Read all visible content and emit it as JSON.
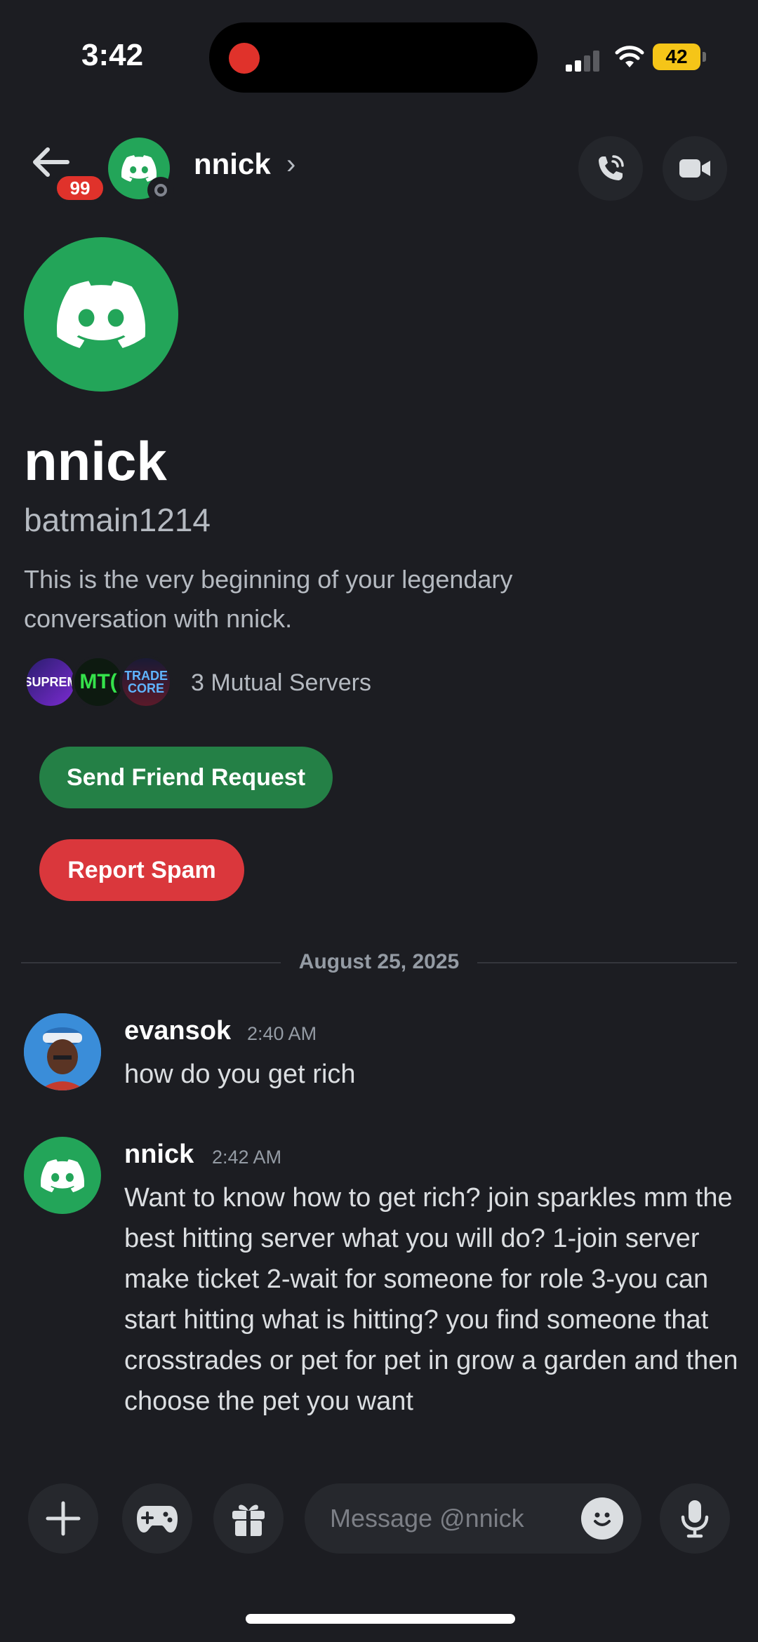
{
  "status_bar": {
    "time": "3:42",
    "battery": "42"
  },
  "header": {
    "badge_count": "99",
    "title": "nnick",
    "chevron": "›"
  },
  "profile": {
    "name": "nnick",
    "username": "batmain1214",
    "intro": "This is the very beginning of your legendary conversation with nnick.",
    "mutual_servers": "3 Mutual Servers",
    "server_icons": [
      {
        "label": "SUPREM"
      },
      {
        "label": "MT("
      },
      {
        "label": "TRADE CORE"
      }
    ],
    "send_friend_request": "Send Friend Request",
    "report_spam": "Report Spam"
  },
  "divider": {
    "date": "August 25, 2025"
  },
  "messages": [
    {
      "author": "evansok",
      "time": "2:40 AM",
      "text": "how do you get rich"
    },
    {
      "author": "nnick",
      "time": "2:42 AM",
      "text": "Want to know how to get rich? join sparkles mm the best hitting server what you will do? 1-join server make ticket 2-wait for someone for role 3-you can start hitting what is hitting? you find someone that crosstrades or pet for pet in grow a garden and then choose the pet you want"
    }
  ],
  "composer": {
    "placeholder": "Message @nnick"
  },
  "colors": {
    "background": "#1c1d22",
    "brand_green": "#23a559",
    "friend_button": "#248046",
    "spam_button": "#da373c",
    "badge_red": "#e0322b"
  },
  "icons": {
    "back": "arrow-left-icon",
    "call": "phone-icon",
    "video": "video-camera-icon",
    "plus": "plus-icon",
    "game": "gamepad-icon",
    "gift": "gift-icon",
    "emoji": "emoji-icon",
    "mic": "microphone-icon"
  }
}
